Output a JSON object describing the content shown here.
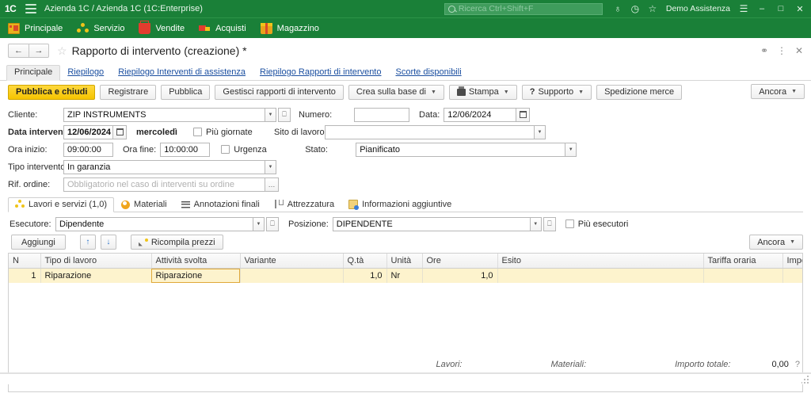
{
  "titlebar": {
    "logo": "1C",
    "app_title": "Azienda 1C / Azienda 1C  (1C:Enterprise)",
    "search_placeholder": "Ricerca Ctrl+Shift+F",
    "user": "Demo Assistenza",
    "icons": {
      "bell": "♁",
      "history": "◷",
      "star": "☆",
      "menu": "☰",
      "minimize": "–",
      "maximize": "□",
      "close": "✕"
    },
    "accent_green": "#1a8038"
  },
  "sections": [
    {
      "label": "Principale",
      "icon": "home-icon"
    },
    {
      "label": "Servizio",
      "icon": "service-icon"
    },
    {
      "label": "Vendite",
      "icon": "cart-icon"
    },
    {
      "label": "Acquisti",
      "icon": "truck-icon"
    },
    {
      "label": "Magazzino",
      "icon": "box-icon"
    }
  ],
  "document": {
    "back": "←",
    "forward": "→",
    "favorite_icon": "☆",
    "title": "Rapporto di intervento (creazione) *",
    "right_icons": {
      "link": "⚭",
      "more": "⋮",
      "close": "✕"
    }
  },
  "nav_tabs": [
    {
      "label": "Principale",
      "active": true
    },
    {
      "label": "Riepilogo",
      "active": false
    },
    {
      "label": "Riepilogo Interventi di assistenza",
      "active": false
    },
    {
      "label": "Riepilogo Rapporti di intervento",
      "active": false
    },
    {
      "label": "Scorte disponibili",
      "active": false
    }
  ],
  "command_bar": {
    "buttons": [
      {
        "label": "Pubblica e chiudi",
        "primary": true,
        "caret": false,
        "icon": ""
      },
      {
        "label": "Registrare",
        "primary": false,
        "caret": false,
        "icon": ""
      },
      {
        "label": "Pubblica",
        "primary": false,
        "caret": false,
        "icon": ""
      },
      {
        "label": "Gestisci rapporti di intervento",
        "primary": false,
        "caret": false,
        "icon": ""
      },
      {
        "label": "Crea sulla base di",
        "primary": false,
        "caret": true,
        "icon": ""
      },
      {
        "label": "Stampa",
        "primary": false,
        "caret": true,
        "icon": "printer-icon"
      },
      {
        "label": "Supporto",
        "primary": false,
        "caret": true,
        "icon": "question-icon"
      },
      {
        "label": "Spedizione merce",
        "primary": false,
        "caret": false,
        "icon": ""
      }
    ],
    "more_label": "Ancora"
  },
  "form": {
    "cliente_label": "Cliente:",
    "cliente_value": "ZIP INSTRUMENTS",
    "numero_label": "Numero:",
    "numero_value": "",
    "data_label": "Data:",
    "data_value": "12/06/2024",
    "data_intervento_label": "Data intervento:",
    "data_intervento_value": "12/06/2024",
    "weekday": "mercoledì",
    "piu_giornate_label": "Più giornate",
    "sito_label": "Sito di lavoro:",
    "sito_value": "",
    "ora_inizio_label": "Ora inizio:",
    "ora_inizio_value": "09:00:00",
    "ora_fine_label": "Ora fine:",
    "ora_fine_value": "10:00:00",
    "urgenza_label": "Urgenza",
    "stato_label": "Stato:",
    "stato_value": "Pianificato",
    "tipo_label": "Tipo intervento:",
    "tipo_value": "In garanzia",
    "rif_label": "Rif. ordine:",
    "rif_placeholder": "Obbligatorio nel caso di interventi su ordine"
  },
  "page_tabs": [
    {
      "label": "Lavori e servizi (1,0)",
      "icon": "works-icon",
      "active": true
    },
    {
      "label": "Materiali",
      "icon": "materials-icon",
      "active": false
    },
    {
      "label": "Annotazioni finali",
      "icon": "notes-icon",
      "active": false
    },
    {
      "label": "Attrezzatura",
      "icon": "tools-icon",
      "active": false
    },
    {
      "label": "Informazioni aggiuntive",
      "icon": "info-icon",
      "active": false
    }
  ],
  "executor": {
    "esecutore_label": "Esecutore:",
    "esecutore_value": "Dipendente",
    "posizione_label": "Posizione:",
    "posizione_value": "DIPENDENTE",
    "piu_esecutori_label": "Più esecutori"
  },
  "grid_toolbar": {
    "add_label": "Aggiungi",
    "move_up_icon": "↑",
    "move_down_icon": "↓",
    "recalc_label": "Ricompila prezzi",
    "more_label": "Ancora"
  },
  "table": {
    "columns": [
      "N",
      "Tipo di lavoro",
      "Attività svolta",
      "Variante",
      "Q.tà",
      "Unità",
      "Ore",
      "Esito",
      "Tariffa oraria",
      "Importo"
    ],
    "rows": [
      {
        "n": "1",
        "tipo_di_lavoro": "Riparazione",
        "attivita_svolta": "Riparazione",
        "variante": "",
        "qta": "1,0",
        "unita": "Nr",
        "ore": "1,0",
        "esito": "",
        "tariffa_oraria": "",
        "importo": ""
      }
    ]
  },
  "footer": {
    "lavori_label": "Lavori:",
    "lavori_value": "",
    "materiali_label": "Materiali:",
    "materiali_value": "",
    "importo_totale_label": "Importo totale:",
    "importo_totale_value": "0,00",
    "help_icon": "?"
  }
}
